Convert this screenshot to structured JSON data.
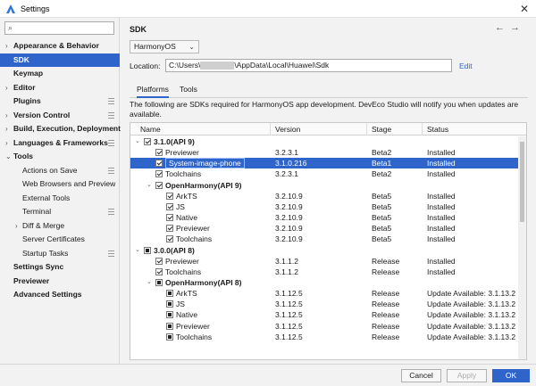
{
  "window": {
    "title": "Settings",
    "close_label": "✕"
  },
  "sidebar": {
    "search_placeholder": "",
    "items": [
      {
        "label": "Appearance & Behavior",
        "arrow": "›",
        "bold": true
      },
      {
        "label": "SDK",
        "bold": true,
        "selected": true
      },
      {
        "label": "Keymap",
        "bold": true
      },
      {
        "label": "Editor",
        "arrow": "›",
        "bold": true
      },
      {
        "label": "Plugins",
        "bold": true,
        "gear": true
      },
      {
        "label": "Version Control",
        "arrow": "›",
        "bold": true,
        "gear": true
      },
      {
        "label": "Build, Execution, Deployment",
        "arrow": "›",
        "bold": true
      },
      {
        "label": "Languages & Frameworks",
        "arrow": "›",
        "bold": true,
        "gear": true
      },
      {
        "label": "Tools",
        "arrow": "⌄",
        "bold": true
      },
      {
        "label": "Actions on Save",
        "indent": 1,
        "gear": true
      },
      {
        "label": "Web Browsers and Preview",
        "indent": 1
      },
      {
        "label": "External Tools",
        "indent": 1
      },
      {
        "label": "Terminal",
        "indent": 1,
        "gear": true
      },
      {
        "label": "Diff & Merge",
        "indent": 1,
        "arrow": "›"
      },
      {
        "label": "Server Certificates",
        "indent": 1
      },
      {
        "label": "Startup Tasks",
        "indent": 1,
        "gear": true
      },
      {
        "label": "Settings Sync",
        "bold": true
      },
      {
        "label": "Previewer",
        "bold": true
      },
      {
        "label": "Advanced Settings",
        "bold": true
      }
    ]
  },
  "main": {
    "title": "SDK",
    "nav_back": "←",
    "nav_forward": "→",
    "platform_select": "HarmonyOS",
    "location_label": "Location:",
    "location_prefix": "C:\\Users\\",
    "location_suffix": "\\AppData\\Local\\Huawei\\Sdk",
    "edit_label": "Edit",
    "tabs": [
      {
        "label": "Platforms",
        "active": true
      },
      {
        "label": "Tools",
        "active": false
      }
    ],
    "description": "The following are SDKs required for HarmonyOS app development. DevEco Studio will notify you when updates are available."
  },
  "table": {
    "headers": [
      "Name",
      "Version",
      "Stage",
      "Status"
    ],
    "rows": [
      {
        "level": 0,
        "toggle": "⌄",
        "check": "on",
        "name": "3.1.0(API 9)",
        "bold": true,
        "version": "",
        "stage": "",
        "status": ""
      },
      {
        "level": 1,
        "check": "on",
        "name": "Previewer",
        "version": "3.2.3.1",
        "stage": "Beta2",
        "status": "Installed"
      },
      {
        "level": 1,
        "check": "on",
        "name": "System-image-phone",
        "version": "3.1.0.216",
        "stage": "Beta1",
        "status": "Installed",
        "selected": true
      },
      {
        "level": 1,
        "check": "on",
        "name": "Toolchains",
        "version": "3.2.3.1",
        "stage": "Beta2",
        "status": "Installed"
      },
      {
        "level": 1,
        "toggle": "⌄",
        "check": "on",
        "name": "OpenHarmony(API 9)",
        "bold": true,
        "version": "",
        "stage": "",
        "status": ""
      },
      {
        "level": 2,
        "check": "on",
        "name": "ArkTS",
        "version": "3.2.10.9",
        "stage": "Beta5",
        "status": "Installed"
      },
      {
        "level": 2,
        "check": "on",
        "name": "JS",
        "version": "3.2.10.9",
        "stage": "Beta5",
        "status": "Installed"
      },
      {
        "level": 2,
        "check": "on",
        "name": "Native",
        "version": "3.2.10.9",
        "stage": "Beta5",
        "status": "Installed"
      },
      {
        "level": 2,
        "check": "on",
        "name": "Previewer",
        "version": "3.2.10.9",
        "stage": "Beta5",
        "status": "Installed"
      },
      {
        "level": 2,
        "check": "on",
        "name": "Toolchains",
        "version": "3.2.10.9",
        "stage": "Beta5",
        "status": "Installed"
      },
      {
        "level": 0,
        "toggle": "⌄",
        "check": "part",
        "name": "3.0.0(API 8)",
        "bold": true,
        "version": "",
        "stage": "",
        "status": ""
      },
      {
        "level": 1,
        "check": "on",
        "name": "Previewer",
        "version": "3.1.1.2",
        "stage": "Release",
        "status": "Installed"
      },
      {
        "level": 1,
        "check": "on",
        "name": "Toolchains",
        "version": "3.1.1.2",
        "stage": "Release",
        "status": "Installed"
      },
      {
        "level": 1,
        "toggle": "⌄",
        "check": "part",
        "name": "OpenHarmony(API 8)",
        "bold": true,
        "version": "",
        "stage": "",
        "status": ""
      },
      {
        "level": 2,
        "check": "part",
        "name": "ArkTS",
        "version": "3.1.12.5",
        "stage": "Release",
        "status": "Update Available: 3.1.13.2"
      },
      {
        "level": 2,
        "check": "part",
        "name": "JS",
        "version": "3.1.12.5",
        "stage": "Release",
        "status": "Update Available: 3.1.13.2"
      },
      {
        "level": 2,
        "check": "part",
        "name": "Native",
        "version": "3.1.12.5",
        "stage": "Release",
        "status": "Update Available: 3.1.13.2"
      },
      {
        "level": 2,
        "check": "part",
        "name": "Previewer",
        "version": "3.1.12.5",
        "stage": "Release",
        "status": "Update Available: 3.1.13.2"
      },
      {
        "level": 2,
        "check": "part",
        "name": "Toolchains",
        "version": "3.1.12.5",
        "stage": "Release",
        "status": "Update Available: 3.1.13.2"
      }
    ]
  },
  "footer": {
    "help_label": "?",
    "cancel_label": "Cancel",
    "apply_label": "Apply",
    "ok_label": "OK"
  },
  "colors": {
    "accent": "#2f65ca",
    "help": "#2f78d6"
  }
}
